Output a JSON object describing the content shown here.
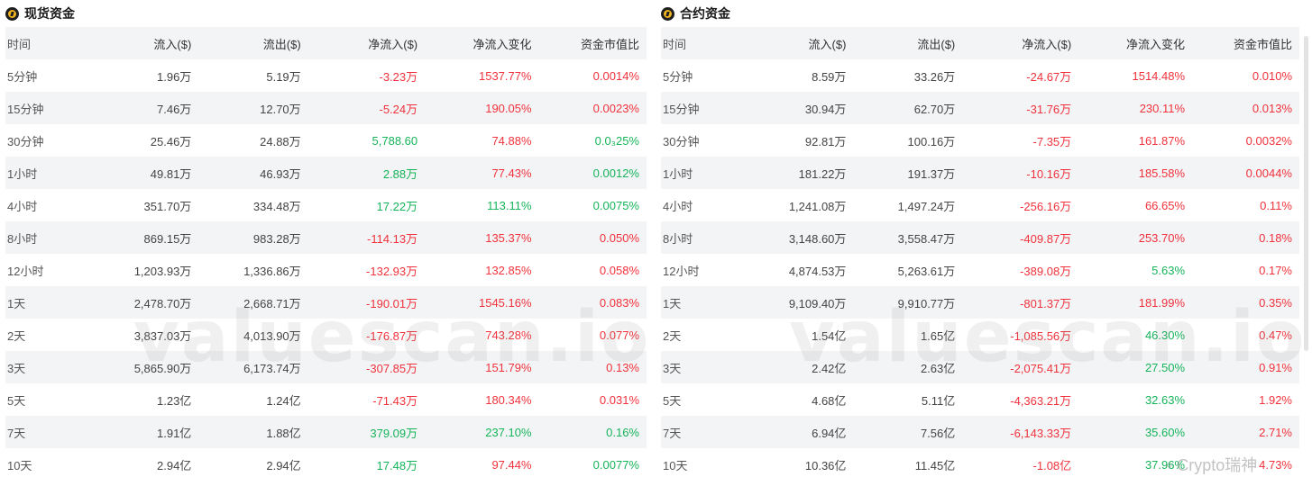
{
  "panels": [
    {
      "title": "现货资金",
      "columns": [
        "时间",
        "流入($)",
        "流出($)",
        "净流入($)",
        "净流入变化",
        "资金市值比"
      ],
      "rows": [
        {
          "time": "5分钟",
          "inflow": "1.96万",
          "outflow": "5.19万",
          "net": "-3.23万",
          "net_color": "red",
          "change": "1537.77%",
          "change_color": "red",
          "ratio": "0.0014%",
          "ratio_color": "red"
        },
        {
          "time": "15分钟",
          "inflow": "7.46万",
          "outflow": "12.70万",
          "net": "-5.24万",
          "net_color": "red",
          "change": "190.05%",
          "change_color": "red",
          "ratio": "0.0023%",
          "ratio_color": "red"
        },
        {
          "time": "30分钟",
          "inflow": "25.46万",
          "outflow": "24.88万",
          "net": "5,788.60",
          "net_color": "green",
          "change": "74.88%",
          "change_color": "red",
          "ratio": "0.0₃25%",
          "ratio_color": "green"
        },
        {
          "time": "1小时",
          "inflow": "49.81万",
          "outflow": "46.93万",
          "net": "2.88万",
          "net_color": "green",
          "change": "77.43%",
          "change_color": "red",
          "ratio": "0.0012%",
          "ratio_color": "green"
        },
        {
          "time": "4小时",
          "inflow": "351.70万",
          "outflow": "334.48万",
          "net": "17.22万",
          "net_color": "green",
          "change": "113.11%",
          "change_color": "green",
          "ratio": "0.0075%",
          "ratio_color": "green"
        },
        {
          "time": "8小时",
          "inflow": "869.15万",
          "outflow": "983.28万",
          "net": "-114.13万",
          "net_color": "red",
          "change": "135.37%",
          "change_color": "red",
          "ratio": "0.050%",
          "ratio_color": "red"
        },
        {
          "time": "12小时",
          "inflow": "1,203.93万",
          "outflow": "1,336.86万",
          "net": "-132.93万",
          "net_color": "red",
          "change": "132.85%",
          "change_color": "red",
          "ratio": "0.058%",
          "ratio_color": "red"
        },
        {
          "time": "1天",
          "inflow": "2,478.70万",
          "outflow": "2,668.71万",
          "net": "-190.01万",
          "net_color": "red",
          "change": "1545.16%",
          "change_color": "red",
          "ratio": "0.083%",
          "ratio_color": "red"
        },
        {
          "time": "2天",
          "inflow": "3,837.03万",
          "outflow": "4,013.90万",
          "net": "-176.87万",
          "net_color": "red",
          "change": "743.28%",
          "change_color": "red",
          "ratio": "0.077%",
          "ratio_color": "red"
        },
        {
          "time": "3天",
          "inflow": "5,865.90万",
          "outflow": "6,173.74万",
          "net": "-307.85万",
          "net_color": "red",
          "change": "151.79%",
          "change_color": "red",
          "ratio": "0.13%",
          "ratio_color": "red"
        },
        {
          "time": "5天",
          "inflow": "1.23亿",
          "outflow": "1.24亿",
          "net": "-71.43万",
          "net_color": "red",
          "change": "180.34%",
          "change_color": "red",
          "ratio": "0.031%",
          "ratio_color": "red"
        },
        {
          "time": "7天",
          "inflow": "1.91亿",
          "outflow": "1.88亿",
          "net": "379.09万",
          "net_color": "green",
          "change": "237.10%",
          "change_color": "green",
          "ratio": "0.16%",
          "ratio_color": "green"
        },
        {
          "time": "10天",
          "inflow": "2.94亿",
          "outflow": "2.94亿",
          "net": "17.48万",
          "net_color": "green",
          "change": "97.44%",
          "change_color": "red",
          "ratio": "0.0077%",
          "ratio_color": "green"
        }
      ]
    },
    {
      "title": "合约资金",
      "columns": [
        "时间",
        "流入($)",
        "流出($)",
        "净流入($)",
        "净流入变化",
        "资金市值比"
      ],
      "rows": [
        {
          "time": "5分钟",
          "inflow": "8.59万",
          "outflow": "33.26万",
          "net": "-24.67万",
          "net_color": "red",
          "change": "1514.48%",
          "change_color": "red",
          "ratio": "0.010%",
          "ratio_color": "red"
        },
        {
          "time": "15分钟",
          "inflow": "30.94万",
          "outflow": "62.70万",
          "net": "-31.76万",
          "net_color": "red",
          "change": "230.11%",
          "change_color": "red",
          "ratio": "0.013%",
          "ratio_color": "red"
        },
        {
          "time": "30分钟",
          "inflow": "92.81万",
          "outflow": "100.16万",
          "net": "-7.35万",
          "net_color": "red",
          "change": "161.87%",
          "change_color": "red",
          "ratio": "0.0032%",
          "ratio_color": "red"
        },
        {
          "time": "1小时",
          "inflow": "181.22万",
          "outflow": "191.37万",
          "net": "-10.16万",
          "net_color": "red",
          "change": "185.58%",
          "change_color": "red",
          "ratio": "0.0044%",
          "ratio_color": "red"
        },
        {
          "time": "4小时",
          "inflow": "1,241.08万",
          "outflow": "1,497.24万",
          "net": "-256.16万",
          "net_color": "red",
          "change": "66.65%",
          "change_color": "red",
          "ratio": "0.11%",
          "ratio_color": "red"
        },
        {
          "time": "8小时",
          "inflow": "3,148.60万",
          "outflow": "3,558.47万",
          "net": "-409.87万",
          "net_color": "red",
          "change": "253.70%",
          "change_color": "red",
          "ratio": "0.18%",
          "ratio_color": "red"
        },
        {
          "time": "12小时",
          "inflow": "4,874.53万",
          "outflow": "5,263.61万",
          "net": "-389.08万",
          "net_color": "red",
          "change": "5.63%",
          "change_color": "green",
          "ratio": "0.17%",
          "ratio_color": "red"
        },
        {
          "time": "1天",
          "inflow": "9,109.40万",
          "outflow": "9,910.77万",
          "net": "-801.37万",
          "net_color": "red",
          "change": "181.99%",
          "change_color": "red",
          "ratio": "0.35%",
          "ratio_color": "red"
        },
        {
          "time": "2天",
          "inflow": "1.54亿",
          "outflow": "1.65亿",
          "net": "-1,085.56万",
          "net_color": "red",
          "change": "46.30%",
          "change_color": "green",
          "ratio": "0.47%",
          "ratio_color": "red"
        },
        {
          "time": "3天",
          "inflow": "2.42亿",
          "outflow": "2.63亿",
          "net": "-2,075.41万",
          "net_color": "red",
          "change": "27.50%",
          "change_color": "green",
          "ratio": "0.91%",
          "ratio_color": "red"
        },
        {
          "time": "5天",
          "inflow": "4.68亿",
          "outflow": "5.11亿",
          "net": "-4,363.21万",
          "net_color": "red",
          "change": "32.63%",
          "change_color": "green",
          "ratio": "1.92%",
          "ratio_color": "red"
        },
        {
          "time": "7天",
          "inflow": "6.94亿",
          "outflow": "7.56亿",
          "net": "-6,143.33万",
          "net_color": "red",
          "change": "35.60%",
          "change_color": "green",
          "ratio": "2.71%",
          "ratio_color": "red"
        },
        {
          "time": "10天",
          "inflow": "10.36亿",
          "outflow": "11.45亿",
          "net": "-1.08亿",
          "net_color": "red",
          "change": "37.96%",
          "change_color": "green",
          "ratio": "4.73%",
          "ratio_color": "red"
        }
      ]
    }
  ],
  "watermark": "valuescan.io",
  "corner_watermark": "Crypto瑞神",
  "colors": {
    "red": "#f0323c",
    "green": "#16b45a",
    "row_alt": "#f3f4f6",
    "icon_gold": "#f2b520"
  }
}
